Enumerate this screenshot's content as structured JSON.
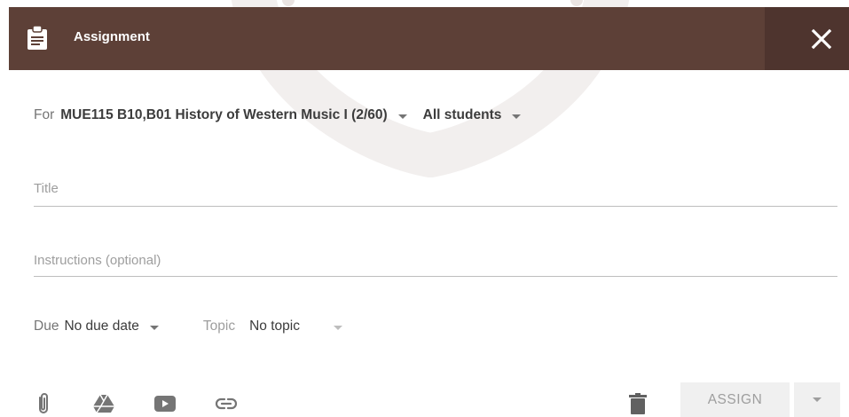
{
  "header": {
    "title": "Assignment",
    "icon": "clipboard-icon",
    "close_icon": "close-icon",
    "bg_color": "#5d4037"
  },
  "form": {
    "for_label": "For",
    "class_value": "MUE115 B10,B01 History of Western Music I (2/60)",
    "audience_value": "All students",
    "title_placeholder": "Title",
    "instructions_placeholder": "Instructions (optional)",
    "due_label": "Due",
    "due_value": "No due date",
    "topic_label": "Topic",
    "topic_value": "No topic"
  },
  "toolbar": {
    "icons": [
      "attach-icon",
      "drive-icon",
      "youtube-icon",
      "link-icon"
    ],
    "delete_icon": "trash-icon",
    "assign_label": "ASSIGN"
  }
}
